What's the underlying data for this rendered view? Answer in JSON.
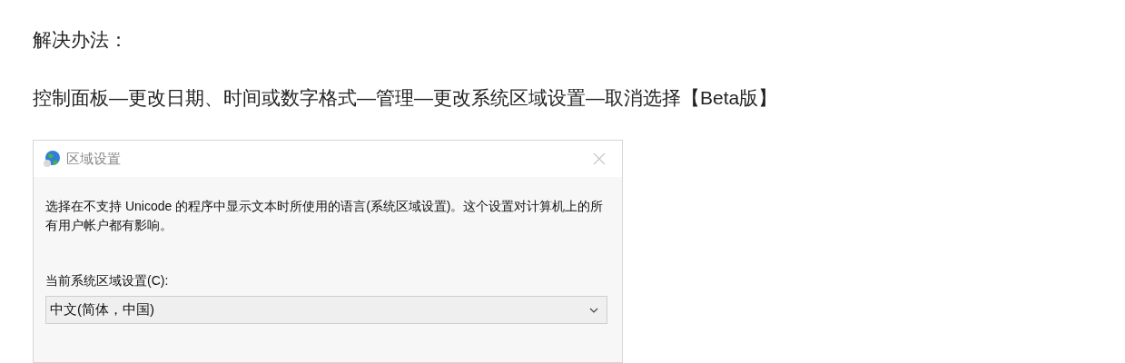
{
  "heading": "解决办法：",
  "steps": "控制面板—更改日期、时间或数字格式—管理—更改系统区域设置—取消选择【Beta版】",
  "dialog": {
    "title": "区域设置",
    "description": "选择在不支持 Unicode 的程序中显示文本时所使用的语言(系统区域设置)。这个设置对计算机上的所有用户帐户都有影响。",
    "field_label": "当前系统区域设置(C):",
    "field_value": "中文(简体，中国)"
  }
}
